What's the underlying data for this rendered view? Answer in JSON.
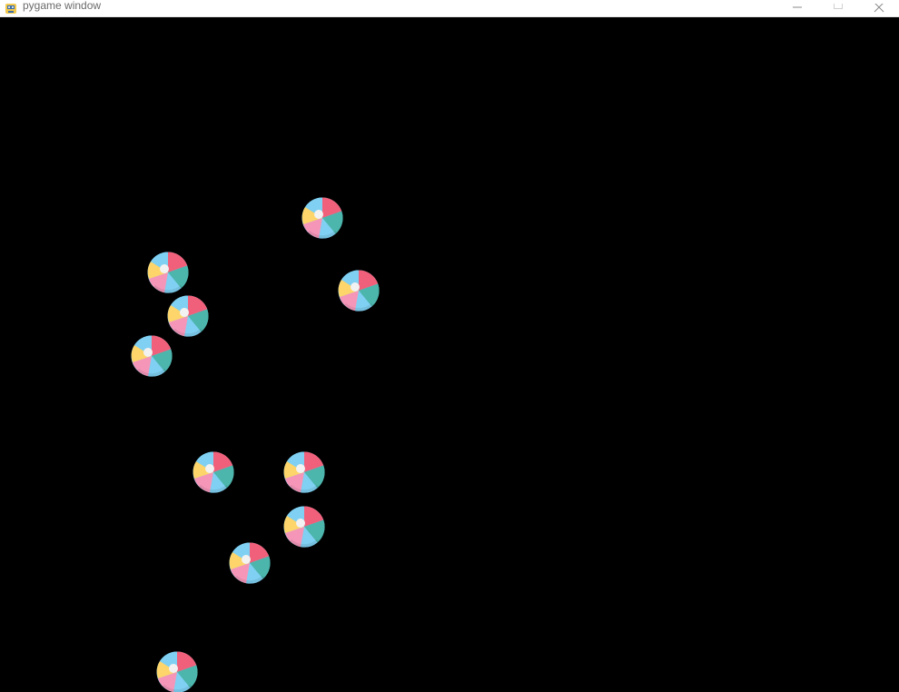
{
  "window": {
    "title": "pygame window",
    "app_icon": "pygame-snake-icon",
    "controls": [
      "minimize-icon",
      "maximize-icon",
      "close-icon"
    ]
  },
  "game": {
    "background_color": "#000000",
    "sprite": "beach-ball-icon",
    "sprite_colors": {
      "red": "#f0607a",
      "teal": "#4cb5ac",
      "blue": "#7fd0f2",
      "yellow": "#fdd56a",
      "pink": "#f596b9",
      "center": "#f2f2f2"
    },
    "ball_count": 10
  }
}
